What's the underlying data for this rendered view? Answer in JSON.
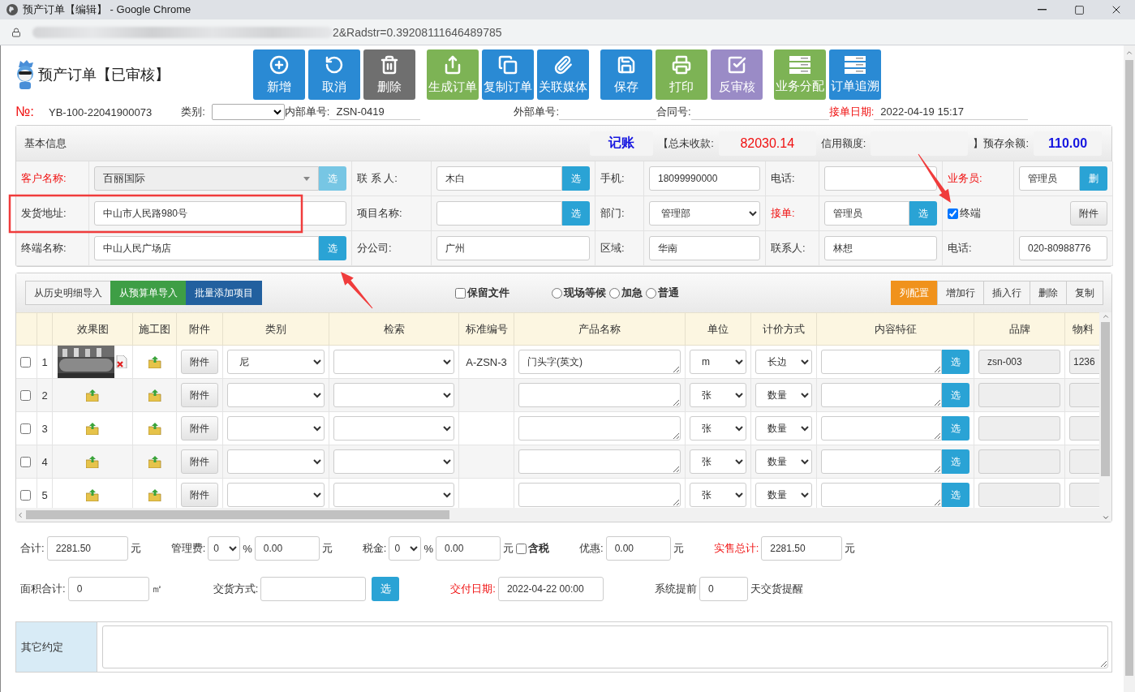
{
  "window": {
    "title": "预产订单【编辑】 - Google Chrome"
  },
  "address_bar": {
    "url": "2&Radstr=0.39208111646489785"
  },
  "page_title": "预产订单【已审核】",
  "toolbar": [
    [
      {
        "label": "新增",
        "color": "#2a8ad4"
      },
      {
        "label": "取消",
        "color": "#2a8ad4"
      },
      {
        "label": "删除",
        "color": "#6f6f6f"
      }
    ],
    [
      {
        "label": "生成订单",
        "color": "#7db355"
      },
      {
        "label": "复制订单",
        "color": "#2a8ad4"
      },
      {
        "label": "关联媒体",
        "color": "#2a8ad4"
      }
    ],
    [
      {
        "label": "保存",
        "color": "#2a8ad4"
      },
      {
        "label": "打印",
        "color": "#7db355"
      },
      {
        "label": "反审核",
        "color": "#9a8bc6"
      }
    ],
    [
      {
        "label": "业务分配",
        "color": "#7db355"
      },
      {
        "label": "订单追溯",
        "color": "#2a8ad4"
      }
    ]
  ],
  "order_info": [
    {
      "label": "№:",
      "required": true,
      "kind": "text",
      "value": "YB-100-22041900073"
    },
    {
      "label": "类别:",
      "required": false,
      "kind": "select"
    },
    {
      "label": "内部单号:",
      "required": false,
      "kind": "line",
      "value": "ZSN-0419"
    },
    {
      "label": "外部单号:",
      "required": false,
      "kind": "line"
    },
    {
      "label": "合同号:",
      "required": false,
      "kind": "line"
    },
    {
      "label": "接单日期:",
      "required": true,
      "kind": "line",
      "value": "2022-04-19 15:17"
    }
  ],
  "basic_info": {
    "title": "基本信息",
    "account": "记账",
    "unpaid_label": "【总未收款:",
    "unpaid": "82030.14",
    "credit_label": "信用额度:",
    "balance_label": "】预存余额:",
    "balance": "110.00",
    "rows": [
      [
        {
          "label": "客户名称:",
          "required": true,
          "kind": "locked",
          "value": "百丽国际",
          "button": "选"
        },
        {
          "label": "联 系 人:",
          "required": false,
          "kind": "pick",
          "value": "木白",
          "button": "选"
        },
        {
          "label": "手机:",
          "required": false,
          "kind": "input",
          "value": "18099990000"
        },
        {
          "label": "电话:",
          "required": false,
          "kind": "input"
        },
        {
          "label": "业务员:",
          "required": true,
          "kind": "pick",
          "value": "管理员",
          "button": "删"
        }
      ],
      [
        {
          "label": "发货地址:",
          "required": false,
          "kind": "input",
          "value": "中山市人民路980号"
        },
        {
          "label": "项目名称:",
          "required": false,
          "kind": "pick",
          "button": "选"
        },
        {
          "label": "部门:",
          "required": false,
          "kind": "select",
          "value": "管理部"
        },
        {
          "label": "接单:",
          "required": true,
          "kind": "pick",
          "value": "管理员",
          "button": "选"
        },
        {
          "label": "终端",
          "kind": "check",
          "checked": true,
          "button": "附件"
        }
      ],
      [
        {
          "label": "终端名称:",
          "required": false,
          "kind": "pick",
          "value": "中山人民广场店",
          "button": "选"
        },
        {
          "label": "分公司:",
          "required": false,
          "kind": "input",
          "value": "广州"
        },
        {
          "label": "区域:",
          "required": false,
          "kind": "input",
          "value": "华南"
        },
        {
          "label": "联系人:",
          "required": false,
          "kind": "input",
          "value": "林想"
        },
        {
          "label": "电话:",
          "required": false,
          "kind": "input",
          "value": "020-80988776"
        }
      ]
    ]
  },
  "items": {
    "left_buttons": [
      {
        "label": "从历史明细导入",
        "color": "#f4f4f4"
      },
      {
        "label": "从预算单导入",
        "color": "#3e9e45"
      },
      {
        "label": "批量添加项目",
        "color": "#22609f"
      }
    ],
    "keep_files": {
      "label": "保留文件",
      "checked": false
    },
    "priority": [
      {
        "label": "现场等候",
        "selected": false
      },
      {
        "label": "加急",
        "selected": false
      },
      {
        "label": "普通",
        "selected": false
      }
    ],
    "right_buttons": [
      {
        "label": "列配置",
        "color": "#f0921c"
      },
      {
        "label": "增加行",
        "color": "#f4f4f4"
      },
      {
        "label": "插入行",
        "color": "#f4f4f4"
      },
      {
        "label": "删除",
        "color": "#f4f4f4"
      },
      {
        "label": "复制",
        "color": "#f4f4f4"
      }
    ],
    "columns": [
      "效果图",
      "施工图",
      "附件",
      "类别",
      "检索",
      "标准编号",
      "产品名称",
      "单位",
      "计价方式",
      "内容特征",
      "品牌",
      "物料"
    ],
    "rows": [
      {
        "checked": false,
        "number": "1",
        "kind": "picture",
        "attach": "附件",
        "category": "尼",
        "standard_no": "A-ZSN-3",
        "product": "门头字(英文)",
        "unit": "m",
        "pricing": "长边",
        "pick": "选",
        "brand": "zsn-003",
        "material": "1236"
      },
      {
        "checked": false,
        "number": "2",
        "kind": "upload",
        "attach": "附件",
        "unit": "张",
        "pricing": "数量",
        "pick": "选"
      },
      {
        "checked": false,
        "number": "3",
        "kind": "upload",
        "attach": "附件",
        "unit": "张",
        "pricing": "数量",
        "pick": "选"
      },
      {
        "checked": false,
        "number": "4",
        "kind": "upload",
        "attach": "附件",
        "unit": "张",
        "pricing": "数量",
        "pick": "选"
      },
      {
        "checked": false,
        "number": "5",
        "kind": "upload",
        "attach": "附件",
        "unit": "张",
        "pricing": "数量",
        "pick": "选"
      }
    ]
  },
  "summary": [
    [
      {
        "kind": "label",
        "text": "合计:",
        "required": false
      },
      {
        "kind": "amount",
        "value": "2281.50"
      },
      {
        "kind": "unit",
        "text": "元"
      },
      {
        "kind": "label",
        "text": "管理费:",
        "required": false
      },
      {
        "kind": "select",
        "value": "0"
      },
      {
        "kind": "unit",
        "text": "%"
      },
      {
        "kind": "rate",
        "value": "0.00"
      },
      {
        "kind": "unit",
        "text": "元"
      },
      {
        "kind": "label",
        "text": "税金:",
        "required": false
      },
      {
        "kind": "select",
        "value": "0"
      },
      {
        "kind": "unit",
        "text": "%"
      },
      {
        "kind": "rate",
        "value": "0.00"
      },
      {
        "kind": "unit",
        "text": "元"
      },
      {
        "kind": "check",
        "text": "含税",
        "checked": false
      },
      {
        "kind": "label",
        "text": "优惠:",
        "required": false
      },
      {
        "kind": "rate",
        "value": "0.00"
      },
      {
        "kind": "unit",
        "text": "元"
      },
      {
        "kind": "label",
        "text": "实售总计:",
        "required": true
      },
      {
        "kind": "amount",
        "value": "2281.50"
      },
      {
        "kind": "unit",
        "text": "元"
      }
    ],
    [
      {
        "kind": "label",
        "text": "面积合计:",
        "required": false
      },
      {
        "kind": "amount",
        "value": "0"
      },
      {
        "kind": "unit",
        "text": "㎡"
      },
      {
        "kind": "label",
        "text": "交货方式:",
        "required": false
      },
      {
        "kind": "date"
      },
      {
        "kind": "button",
        "text": "选"
      },
      {
        "kind": "label",
        "text": "交付日期:",
        "required": true
      },
      {
        "kind": "date",
        "value": "2022-04-22 00:00"
      },
      {
        "kind": "label",
        "text": "系统提前",
        "required": false
      },
      {
        "kind": "days",
        "value": "0"
      },
      {
        "kind": "unit",
        "text": "天交货提醒"
      }
    ]
  ],
  "other_terms": {
    "label": "其它约定"
  }
}
